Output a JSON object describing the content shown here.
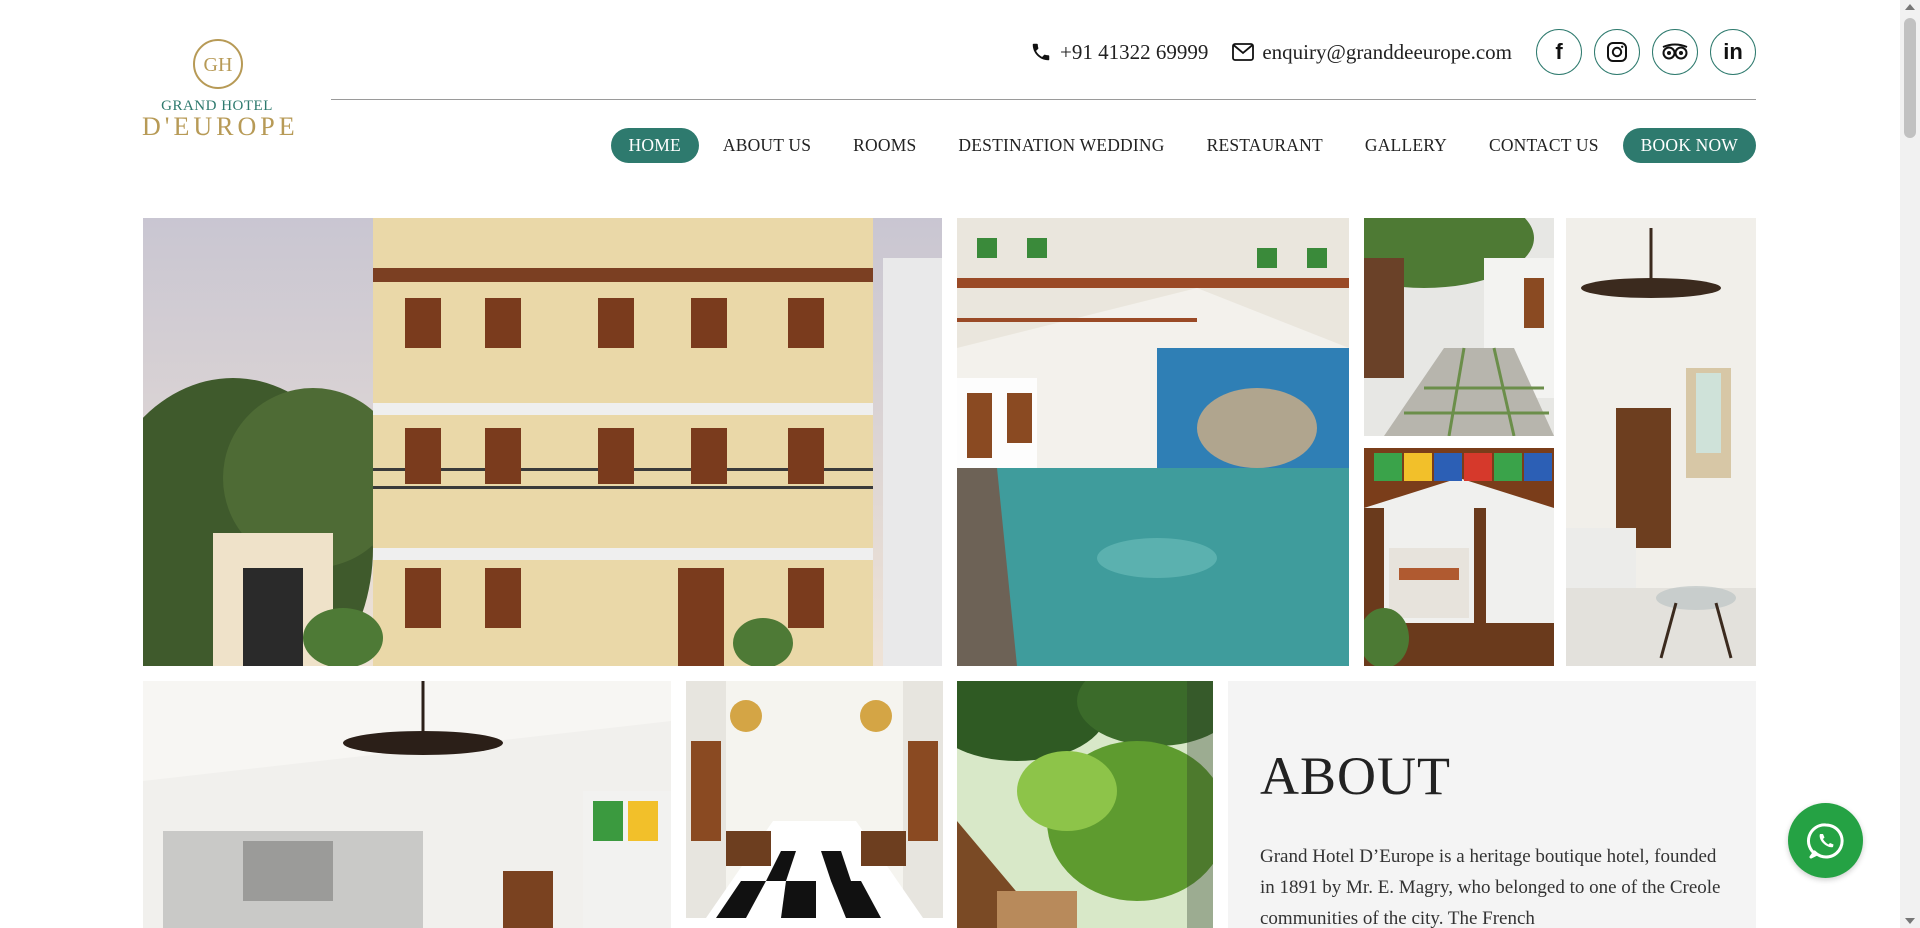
{
  "header": {
    "logo": {
      "line1": "GRAND HOTEL",
      "line2": "D'EUROPE",
      "monogram": "GH"
    },
    "phone": "+91 41322 69999",
    "email": "enquiry@granddeeurope.com",
    "social": [
      {
        "name": "facebook-icon",
        "glyph": "f"
      },
      {
        "name": "instagram-icon",
        "glyph": ""
      },
      {
        "name": "tripadvisor-icon",
        "glyph": ""
      },
      {
        "name": "linkedin-icon",
        "glyph": "in"
      }
    ]
  },
  "nav": {
    "items": [
      "HOME",
      "ABOUT US",
      "ROOMS",
      "DESTINATION WEDDING",
      "RESTAURANT",
      "GALLERY",
      "CONTACT US"
    ],
    "active": "HOME",
    "book": "BOOK NOW"
  },
  "about": {
    "heading": "ABOUT",
    "text": "Grand Hotel D’Europe is a heritage boutique hotel, founded in 1891 by Mr. E. Magry, who belonged to one of the Creole communities of the city. The French"
  },
  "colors": {
    "brand_green": "#2e7a6e",
    "brand_gold": "#b79a56",
    "whatsapp": "#25a244"
  }
}
